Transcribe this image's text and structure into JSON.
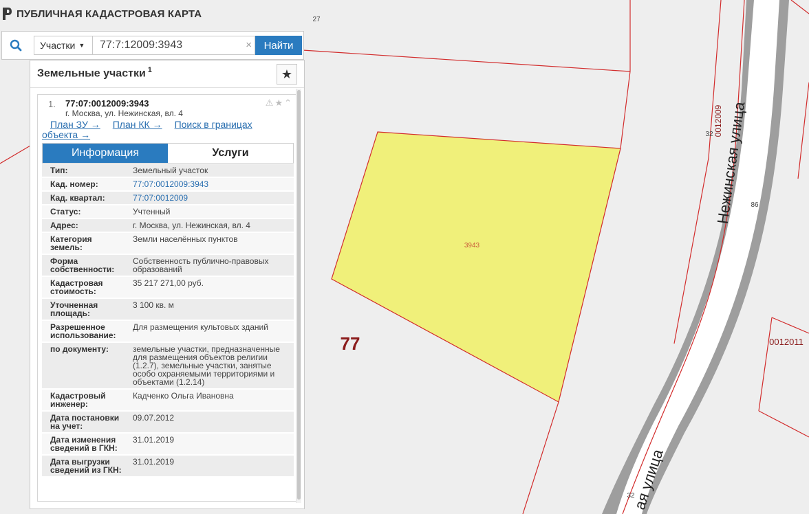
{
  "app": {
    "title": "ПУБЛИЧНАЯ КАДАСТРОВАЯ КАРТА"
  },
  "search": {
    "type_label": "Участки",
    "query_value": "77:7:12009:3943",
    "find_label": "Найти"
  },
  "panel": {
    "title": "Земельные участки",
    "count": "1",
    "result": {
      "index": "1.",
      "cad_number": "77:07:0012009:3943",
      "address": "г. Москва, ул. Нежинская, вл. 4",
      "links": {
        "plan_zu": "План ЗУ →",
        "plan_kk": "План КК →",
        "search_bounds": "Поиск в границах объекта →"
      },
      "tabs": {
        "info": "Информация",
        "services": "Услуги"
      },
      "properties": [
        {
          "key": "Тип:",
          "value": "Земельный участок"
        },
        {
          "key": "Кад. номер:",
          "value": "77:07:0012009:3943",
          "link": true
        },
        {
          "key": "Кад. квартал:",
          "value": "77:07:0012009",
          "link": true
        },
        {
          "key": "Статус:",
          "value": "Учтенный"
        },
        {
          "key": "Адрес:",
          "value": "г. Москва, ул. Нежинская, вл. 4"
        },
        {
          "key": "Категория земель:",
          "value": "Земли населённых пунктов"
        },
        {
          "key": "Форма собственности:",
          "value": "Собственность публично-правовых образований"
        },
        {
          "key": "Кадастровая стоимость:",
          "value": "35 217 271,00 руб."
        },
        {
          "key": "Уточненная площадь:",
          "value": "3 100 кв. м"
        },
        {
          "key": "Разрешенное использование:",
          "value": "Для размещения культовых зданий"
        },
        {
          "key": "по документу:",
          "value": "земельные участки, предназначенные для размещения объектов религии (1.2.7), земельные участки, занятые особо охраняемыми территориями и объектами (1.2.14)"
        },
        {
          "key": "Кадастровый инженер:",
          "value": "Кадченко Ольга Ивановна"
        },
        {
          "key": "Дата постановки на учет:",
          "value": "09.07.2012"
        },
        {
          "key": "Дата изменения сведений в ГКН:",
          "value": "31.01.2019"
        },
        {
          "key": "Дата выгрузки сведений из ГКН:",
          "value": "31.01.2019"
        }
      ]
    }
  },
  "map": {
    "labels": {
      "parcel_number": "3943",
      "district": "77",
      "street": "Нежинская улица",
      "street_bottom": "ая улица",
      "quarter_east": "0012009",
      "quarter_se": "0012011",
      "lbl_27": "27",
      "lbl_32_top": "32",
      "lbl_86": "86",
      "lbl_32_bottom": "32"
    },
    "colors": {
      "parcel_fill": "#f0f07a",
      "boundary": "#d22c2c",
      "road": "#9e9e9e",
      "background": "#eeeeee"
    }
  }
}
